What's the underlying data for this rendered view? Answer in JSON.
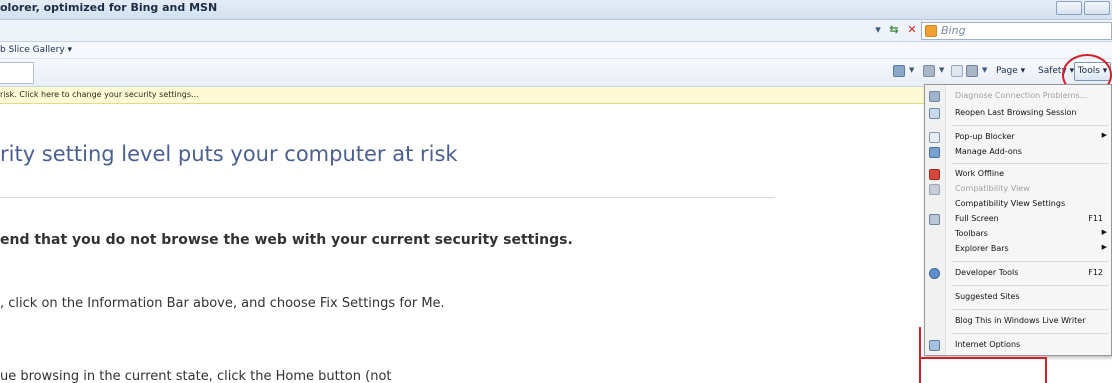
{
  "window": {
    "title": "olorer, optimized for Bing and MSN"
  },
  "address_bar": {
    "search_placeholder": "Bing"
  },
  "favorites_bar": {
    "web_slice_gallery": "b Slice Gallery ▾"
  },
  "command_bar": {
    "page_label": "Page ▾",
    "safety_label": "Safety ▾",
    "tools_label": "Tools ▾"
  },
  "info_bar": {
    "message": "risk. Click here to change your security settings..."
  },
  "content": {
    "heading": "rity setting level puts your computer at risk",
    "bold_line": "end that you do not browse the web with your current security settings.",
    "line2": ", click on the Information Bar above, and choose Fix Settings for Me.",
    "line3": "ue browsing in the current state, click the Home button (not"
  },
  "tools_menu": {
    "items": [
      {
        "label": "Diagnose Connection Problems...",
        "disabled": true,
        "icon": "network-icon"
      },
      {
        "label": "Reopen Last Browsing Session",
        "disabled": false,
        "icon": "reopen-icon"
      },
      {
        "label": "Pop-up Blocker",
        "disabled": false,
        "icon": "popup-icon",
        "submenu": true
      },
      {
        "label": "Manage Add-ons",
        "disabled": false,
        "icon": "addons-icon"
      },
      {
        "label": "Work Offline",
        "disabled": false,
        "icon": "offline-icon"
      },
      {
        "label": "Compatibility View",
        "disabled": true,
        "icon": "compat-icon"
      },
      {
        "label": "Compatibility View Settings",
        "disabled": false
      },
      {
        "label": "Full Screen",
        "disabled": false,
        "icon": "fullscreen-icon",
        "shortcut": "F11"
      },
      {
        "label": "Toolbars",
        "disabled": false,
        "submenu": true
      },
      {
        "label": "Explorer Bars",
        "disabled": false,
        "submenu": true
      },
      {
        "label": "Developer Tools",
        "disabled": false,
        "icon": "devtools-icon",
        "shortcut": "F12"
      },
      {
        "label": "Suggested Sites",
        "disabled": false
      },
      {
        "label": "Blog This in Windows Live Writer",
        "disabled": false
      },
      {
        "label": "Internet Options",
        "disabled": false,
        "icon": "options-icon"
      }
    ]
  },
  "colors": {
    "annotation_red": "#d0202a",
    "heading_blue": "#4a5f92",
    "infobar_yellow": "#fefbd4"
  }
}
